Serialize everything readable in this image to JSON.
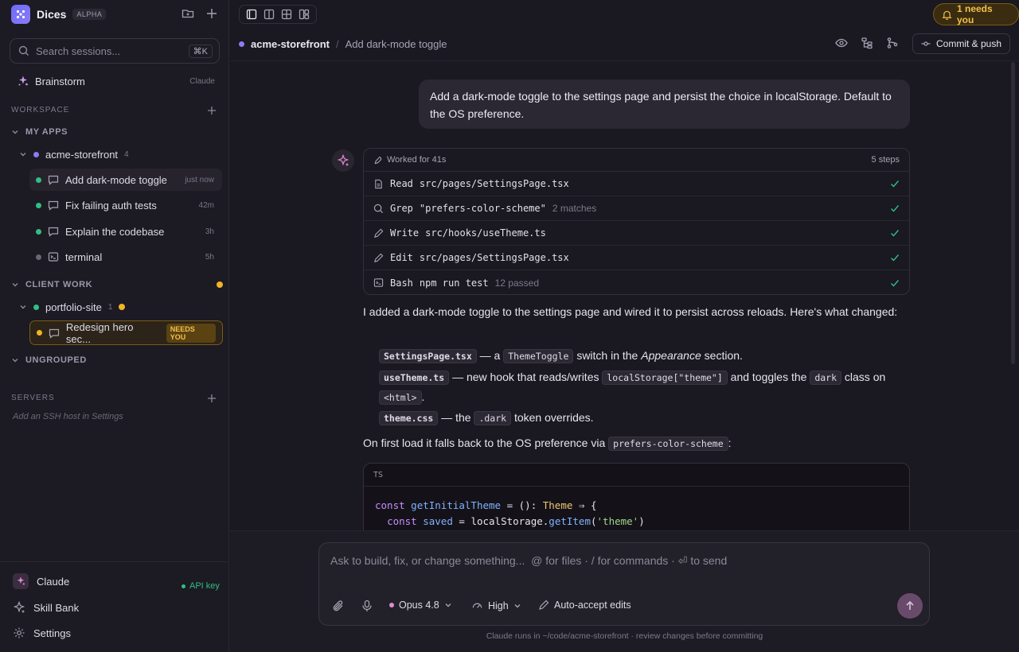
{
  "brand": {
    "name": "Dices",
    "badge": "ALPHA"
  },
  "search": {
    "placeholder": "Search sessions...",
    "shortcut": "⌘K"
  },
  "brainstorm": {
    "label": "Brainstorm",
    "agent": "Claude"
  },
  "workspace": {
    "section_label": "WORKSPACE",
    "groups": [
      {
        "label": "MY APPS",
        "projects": [
          {
            "name": "acme-storefront",
            "count": "4",
            "sessions": [
              {
                "label": "Add dark-mode toggle",
                "time": "just now",
                "status": "green"
              },
              {
                "label": "Fix failing auth tests",
                "time": "42m",
                "status": "green"
              },
              {
                "label": "Explain the codebase",
                "time": "3h",
                "status": "green"
              },
              {
                "label": "terminal",
                "time": "5h",
                "status": "gray"
              }
            ]
          }
        ]
      },
      {
        "label": "CLIENT WORK",
        "projects": [
          {
            "name": "portfolio-site",
            "count": "1",
            "sessions": [
              {
                "label": "Redesign hero sec...",
                "badge": "NEEDS YOU",
                "status": "amber"
              }
            ]
          }
        ]
      },
      {
        "label": "UNGROUPED"
      }
    ]
  },
  "servers": {
    "section_label": "SERVERS",
    "hint": "Add an SSH host in Settings"
  },
  "footer": {
    "agent_label": "Claude",
    "api_label": "API key",
    "skill_bank": "Skill Bank",
    "settings": "Settings"
  },
  "topbar": {
    "notify": "1 needs you"
  },
  "header": {
    "repo": "acme-storefront",
    "separator": "/",
    "title": "Add dark-mode toggle",
    "commit_label": "Commit & push"
  },
  "user_message": "Add a dark-mode toggle to the settings page and persist the choice in localStorage. Default to the OS preference.",
  "work": {
    "summary": "Worked for 41s",
    "steps_count": "5 steps",
    "steps": [
      {
        "icon": "file-icon",
        "action": "Read",
        "target": "src/pages/SettingsPage.tsx",
        "note": ""
      },
      {
        "icon": "search-icon",
        "action": "Grep",
        "target": "\"prefers-color-scheme\"",
        "note": "2 matches"
      },
      {
        "icon": "pencil-icon",
        "action": "Write",
        "target": "src/hooks/useTheme.ts",
        "note": ""
      },
      {
        "icon": "pencil-icon",
        "action": "Edit",
        "target": "src/pages/SettingsPage.tsx",
        "note": ""
      },
      {
        "icon": "terminal-icon",
        "action": "Bash",
        "target": "npm run test",
        "note": "12 passed"
      }
    ]
  },
  "answer": {
    "intro": "I added a dark-mode toggle to the settings page and wired it to persist across reloads. Here's what changed:",
    "b1": {
      "file": "SettingsPage.tsx",
      "t1": "— a",
      "code": "ThemeToggle",
      "t2": "switch in the",
      "em": "Appearance",
      "t3": "section."
    },
    "b2": {
      "file": "useTheme.ts",
      "t1": "— new hook that reads/writes",
      "code1": "localStorage[\"theme\"]",
      "t2": "and toggles the",
      "code2": "dark",
      "t3": "class on",
      "code3": "<html>",
      "t4": "."
    },
    "b3": {
      "file": "theme.css",
      "t1": "— the",
      "code": ".dark",
      "t2": "token overrides."
    },
    "fallback": {
      "text": "On first load it falls back to the OS preference via",
      "code": "prefers-color-scheme",
      "end": ":"
    },
    "code_lang": "TS",
    "code_line1": {
      "kw": "const",
      "fn": "getInitialTheme",
      "op": " = (): ",
      "type": "Theme",
      "arrow": " ⇒ {"
    },
    "code_line2": {
      "kw": "const",
      "var": "saved",
      "op": " = ",
      "obj": "localStorage",
      "dot": ".",
      "fn": "getItem",
      "paren": "(",
      "str": "'theme'",
      "close": ")"
    }
  },
  "composer": {
    "placeholder": "Ask to build, fix, or change something...  @ for files · / for commands · ⏎ to send",
    "model": "Opus 4.8",
    "effort": "High",
    "auto_accept": "Auto-accept edits",
    "footnote": "Claude runs in ~/code/acme-storefront · review changes before committing"
  },
  "colors": {
    "accent": "#8b7cf6",
    "success": "#2fbf84",
    "warning": "#f0b429"
  }
}
